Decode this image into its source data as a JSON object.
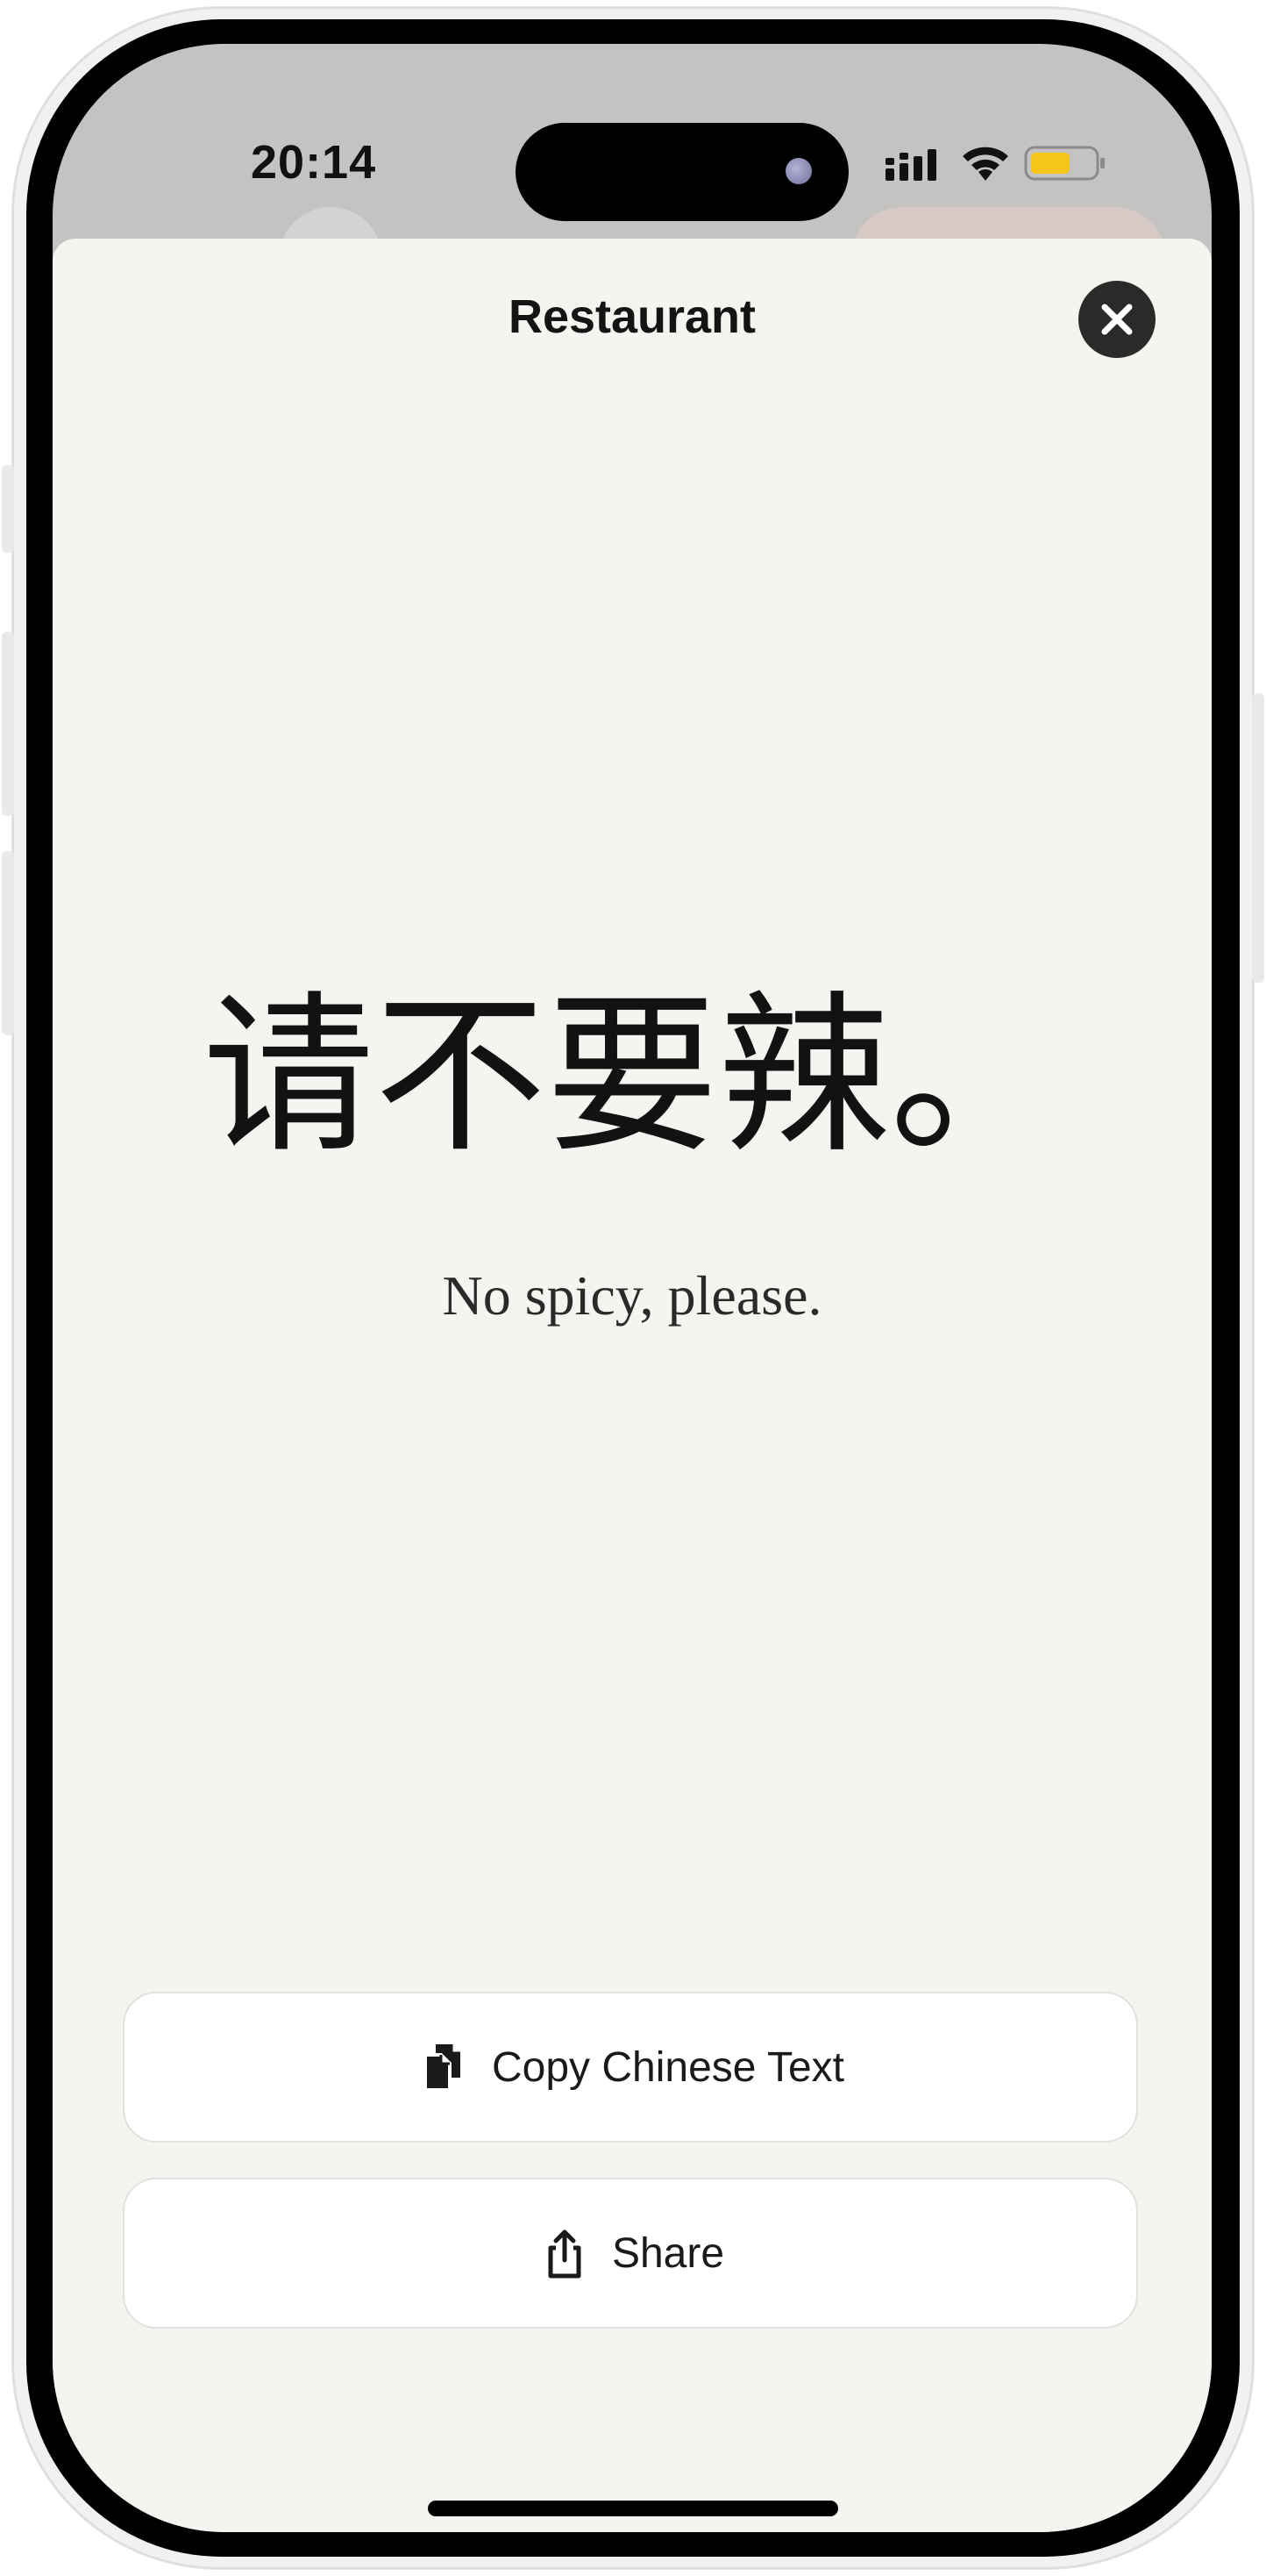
{
  "status_bar": {
    "time": "20:14",
    "icons": [
      "cellular-signal-icon",
      "wifi-icon",
      "battery-icon"
    ],
    "battery_color": "#f5c518"
  },
  "sheet": {
    "title": "Restaurant",
    "close_icon": "close-icon"
  },
  "phrase": {
    "chinese": "请不要辣。",
    "english": "No spicy, please."
  },
  "actions": {
    "copy_label": "Copy Chinese Text",
    "copy_icon": "copy-icon",
    "share_label": "Share",
    "share_icon": "share-icon"
  },
  "colors": {
    "sheet_background": "#f5f4f1",
    "close_button": "#2b2a28",
    "button_background": "#ffffff"
  }
}
